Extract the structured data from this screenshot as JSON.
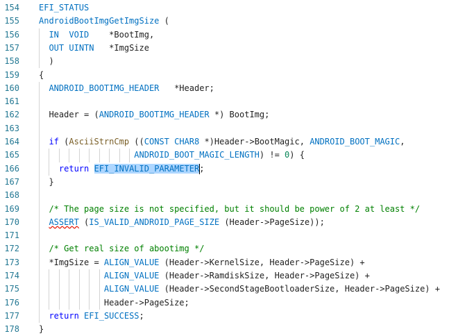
{
  "editor": {
    "lines": [
      {
        "num": "154",
        "tokens": [
          {
            "t": "EFI_STATUS",
            "c": "m"
          }
        ]
      },
      {
        "num": "155",
        "tokens": [
          {
            "t": "AndroidBootImgGetImgSize",
            "c": "m"
          },
          {
            "t": " (",
            "c": "p"
          }
        ]
      },
      {
        "num": "156",
        "tokens": [
          {
            "t": "  ",
            "c": "p"
          },
          {
            "t": "IN",
            "c": "m"
          },
          {
            "t": "  ",
            "c": "p"
          },
          {
            "t": "VOID",
            "c": "m"
          },
          {
            "t": "    *BootImg,",
            "c": "p"
          }
        ]
      },
      {
        "num": "157",
        "tokens": [
          {
            "t": "  ",
            "c": "p"
          },
          {
            "t": "OUT",
            "c": "m"
          },
          {
            "t": " ",
            "c": "p"
          },
          {
            "t": "UINTN",
            "c": "m"
          },
          {
            "t": "   *ImgSize",
            "c": "p"
          }
        ]
      },
      {
        "num": "158",
        "tokens": [
          {
            "t": "  )",
            "c": "p"
          }
        ]
      },
      {
        "num": "159",
        "tokens": [
          {
            "t": "{",
            "c": "p"
          }
        ]
      },
      {
        "num": "160",
        "tokens": [
          {
            "t": "  ",
            "c": "p"
          },
          {
            "t": "ANDROID_BOOTIMG_HEADER",
            "c": "m"
          },
          {
            "t": "   *Header;",
            "c": "p"
          }
        ]
      },
      {
        "num": "161",
        "tokens": []
      },
      {
        "num": "162",
        "tokens": [
          {
            "t": "  Header = (",
            "c": "p"
          },
          {
            "t": "ANDROID_BOOTIMG_HEADER",
            "c": "m"
          },
          {
            "t": " *) BootImg;",
            "c": "p"
          }
        ]
      },
      {
        "num": "163",
        "tokens": []
      },
      {
        "num": "164",
        "tokens": [
          {
            "t": "  ",
            "c": "p"
          },
          {
            "t": "if",
            "c": "k"
          },
          {
            "t": " (",
            "c": "p"
          },
          {
            "t": "AsciiStrnCmp",
            "c": "f"
          },
          {
            "t": " ((",
            "c": "p"
          },
          {
            "t": "CONST",
            "c": "m"
          },
          {
            "t": " ",
            "c": "p"
          },
          {
            "t": "CHAR8",
            "c": "m"
          },
          {
            "t": " *)Header->BootMagic, ",
            "c": "p"
          },
          {
            "t": "ANDROID_BOOT_MAGIC",
            "c": "m"
          },
          {
            "t": ",",
            "c": "p"
          }
        ]
      },
      {
        "num": "165",
        "tokens": [
          {
            "t": "                   ",
            "c": "p"
          },
          {
            "t": "ANDROID_BOOT_MAGIC_LENGTH",
            "c": "m"
          },
          {
            "t": ") != ",
            "c": "p"
          },
          {
            "t": "0",
            "c": "n"
          },
          {
            "t": ") {",
            "c": "p"
          }
        ]
      },
      {
        "num": "166",
        "tokens": [
          {
            "t": "    ",
            "c": "p"
          },
          {
            "t": "return",
            "c": "k"
          },
          {
            "t": " ",
            "c": "p"
          },
          {
            "t": "EFI_INVALID_PARAMETER",
            "c": "m",
            "sel": true
          },
          {
            "t": ";",
            "c": "p"
          }
        ]
      },
      {
        "num": "167",
        "tokens": [
          {
            "t": "  }",
            "c": "p"
          }
        ]
      },
      {
        "num": "168",
        "tokens": []
      },
      {
        "num": "169",
        "tokens": [
          {
            "t": "  /* The page size is not specified, but it should be power of 2 at least */",
            "c": "c"
          }
        ]
      },
      {
        "num": "170",
        "tokens": [
          {
            "t": "  ",
            "c": "p"
          },
          {
            "t": "ASSERT",
            "c": "m",
            "squiggle": true
          },
          {
            "t": " (",
            "c": "p"
          },
          {
            "t": "IS_VALID_ANDROID_PAGE_SIZE",
            "c": "m"
          },
          {
            "t": " (Header->PageSize));",
            "c": "p"
          }
        ]
      },
      {
        "num": "171",
        "tokens": []
      },
      {
        "num": "172",
        "tokens": [
          {
            "t": "  /* Get real size of abootimg */",
            "c": "c"
          }
        ]
      },
      {
        "num": "173",
        "tokens": [
          {
            "t": "  *ImgSize = ",
            "c": "p"
          },
          {
            "t": "ALIGN_VALUE",
            "c": "m"
          },
          {
            "t": " (Header->KernelSize, Header->PageSize) +",
            "c": "p"
          }
        ]
      },
      {
        "num": "174",
        "tokens": [
          {
            "t": "             ",
            "c": "p"
          },
          {
            "t": "ALIGN_VALUE",
            "c": "m"
          },
          {
            "t": " (Header->RamdiskSize, Header->PageSize) +",
            "c": "p"
          }
        ]
      },
      {
        "num": "175",
        "tokens": [
          {
            "t": "             ",
            "c": "p"
          },
          {
            "t": "ALIGN_VALUE",
            "c": "m"
          },
          {
            "t": " (Header->SecondStageBootloaderSize, Header->PageSize) +",
            "c": "p"
          }
        ]
      },
      {
        "num": "176",
        "tokens": [
          {
            "t": "             Header->PageSize;",
            "c": "p"
          }
        ]
      },
      {
        "num": "177",
        "tokens": [
          {
            "t": "  ",
            "c": "p"
          },
          {
            "t": "return",
            "c": "k"
          },
          {
            "t": " ",
            "c": "p"
          },
          {
            "t": "EFI_SUCCESS",
            "c": "m"
          },
          {
            "t": ";",
            "c": "p"
          }
        ]
      },
      {
        "num": "178",
        "tokens": [
          {
            "t": "}",
            "c": "p"
          }
        ]
      }
    ]
  }
}
